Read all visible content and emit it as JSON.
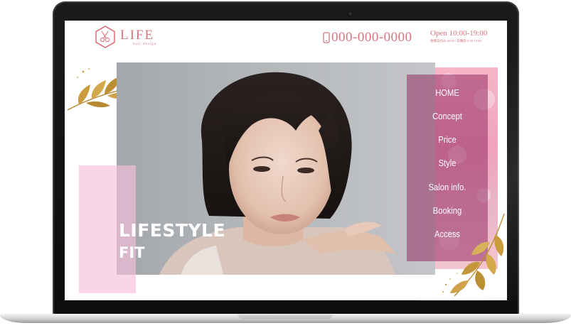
{
  "header": {
    "logo_word": "LIFE",
    "logo_sub": "hair design",
    "phone": "000-000-0000",
    "hours": "Open 10:00-19:00",
    "hours_note": "金曜日のみ 20:00 / 日曜日 9:30-17:00"
  },
  "hero": {
    "title_line1": "LIFESTYLE",
    "title_line2": "FIT"
  },
  "nav": {
    "items": [
      {
        "label": "HOME"
      },
      {
        "label": "Concept"
      },
      {
        "label": "Price"
      },
      {
        "label": "Style"
      },
      {
        "label": "Salon info."
      },
      {
        "label": "Booking"
      },
      {
        "label": "Access"
      }
    ]
  },
  "colors": {
    "brand": "#d9747f",
    "menu_overlay": "#962d64",
    "pink_accent": "#f8bedc",
    "gold_leaf": "#c79a3c"
  },
  "icons": [
    "logo-hexagon-scissors-icon",
    "phone-icon",
    "gold-leaf-decoration"
  ]
}
